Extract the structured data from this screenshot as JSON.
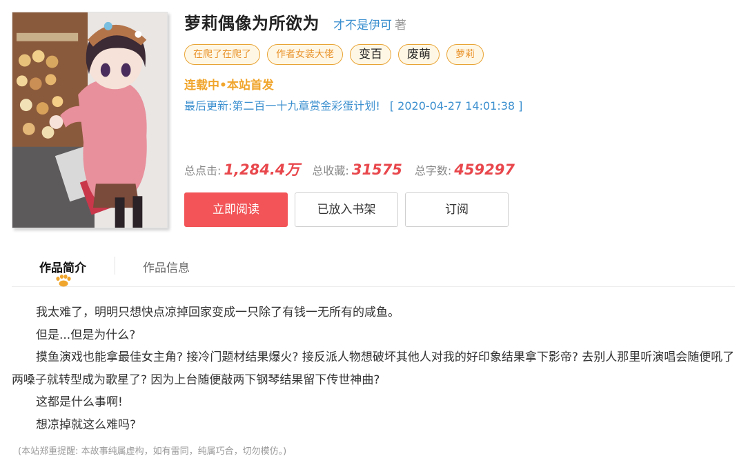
{
  "book": {
    "title": "萝莉偶像为所欲为",
    "author": "才不是伊可",
    "author_suffix": "著",
    "tags": [
      "在爬了在爬了",
      "作者女装大佬",
      "变百",
      "废萌",
      "萝莉"
    ],
    "status": "连载中•本站首发",
    "last_update_label": "最后更新:",
    "last_update_chapter": "第二百一十九章赏金彩蛋计划!",
    "last_update_time": "[ 2020-04-27 14:01:38 ]"
  },
  "stats": {
    "clicks_label": "总点击:",
    "clicks_value": "1,284.4万",
    "favorites_label": "总收藏:",
    "favorites_value": "31575",
    "words_label": "总字数:",
    "words_value": "459297"
  },
  "buttons": {
    "read": "立即阅读",
    "shelf": "已放入书架",
    "subscribe": "订阅"
  },
  "tabs": {
    "intro": "作品简介",
    "info": "作品信息"
  },
  "intro_paragraphs": [
    "我太难了，明明只想快点凉掉回家变成一只除了有钱一无所有的咸鱼。",
    "但是...但是为什么?",
    "摸鱼演戏也能拿最佳女主角? 接冷门题材结果爆火? 接反派人物想破坏其他人对我的好印象结果拿下影帝? 去别人那里听演唱会随便吼了两嗓子就转型成为歌星了? 因为上台随便敲两下钢琴结果留下传世神曲?",
    "这都是什么事啊!",
    "想凉掉就这么难吗?"
  ],
  "disclaimer": "(本站郑重提醒: 本故事纯属虚构，如有雷同，纯属巧合，切勿模仿。)",
  "colors": {
    "accent_red": "#f25457",
    "link_blue": "#3b8fcf",
    "tag_orange": "#e8a434",
    "status_orange": "#f0a52c",
    "stat_red": "#e8474c"
  }
}
